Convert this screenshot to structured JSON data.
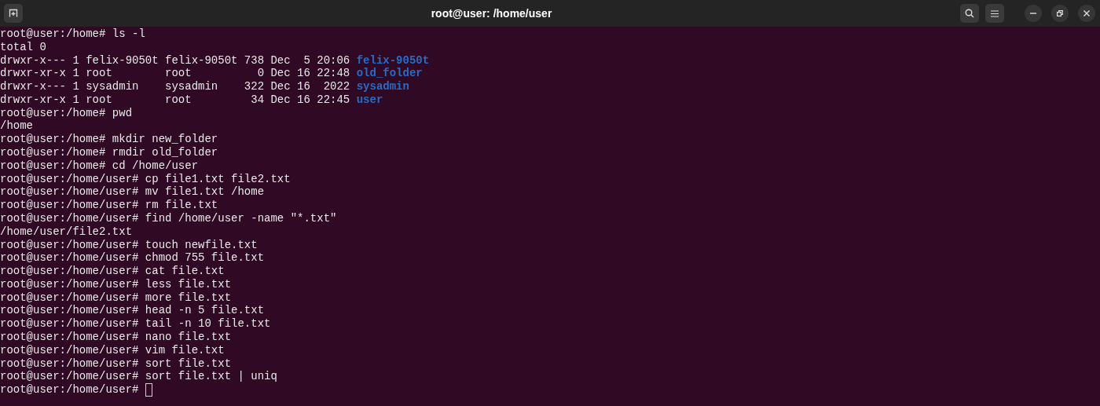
{
  "window": {
    "title": "root@user: /home/user"
  },
  "lines": [
    {
      "text": "root@user:/home# ls -l"
    },
    {
      "text": "total 0"
    },
    {
      "text": "drwxr-x--- 1 felix-9050t felix-9050t 738 Dec  5 20:06 ",
      "dir": "felix-9050t"
    },
    {
      "text": "drwxr-xr-x 1 root        root          0 Dec 16 22:48 ",
      "dir": "old_folder"
    },
    {
      "text": "drwxr-x--- 1 sysadmin    sysadmin    322 Dec 16  2022 ",
      "dir": "sysadmin"
    },
    {
      "text": "drwxr-xr-x 1 root        root         34 Dec 16 22:45 ",
      "dir": "user"
    },
    {
      "text": "root@user:/home# pwd"
    },
    {
      "text": "/home"
    },
    {
      "text": "root@user:/home# mkdir new_folder"
    },
    {
      "text": "root@user:/home# rmdir old_folder"
    },
    {
      "text": "root@user:/home# cd /home/user"
    },
    {
      "text": "root@user:/home/user# cp file1.txt file2.txt"
    },
    {
      "text": "root@user:/home/user# mv file1.txt /home"
    },
    {
      "text": "root@user:/home/user# rm file.txt"
    },
    {
      "text": "root@user:/home/user# find /home/user -name \"*.txt\""
    },
    {
      "text": "/home/user/file2.txt"
    },
    {
      "text": "root@user:/home/user# touch newfile.txt"
    },
    {
      "text": "root@user:/home/user# chmod 755 file.txt"
    },
    {
      "text": "root@user:/home/user# cat file.txt"
    },
    {
      "text": "root@user:/home/user# less file.txt"
    },
    {
      "text": "root@user:/home/user# more file.txt"
    },
    {
      "text": "root@user:/home/user# head -n 5 file.txt"
    },
    {
      "text": "root@user:/home/user# tail -n 10 file.txt"
    },
    {
      "text": "root@user:/home/user# nano file.txt"
    },
    {
      "text": "root@user:/home/user# vim file.txt"
    },
    {
      "text": "root@user:/home/user# sort file.txt"
    },
    {
      "text": "root@user:/home/user# sort file.txt | uniq"
    },
    {
      "text": "root@user:/home/user# ",
      "cursor": true
    }
  ]
}
